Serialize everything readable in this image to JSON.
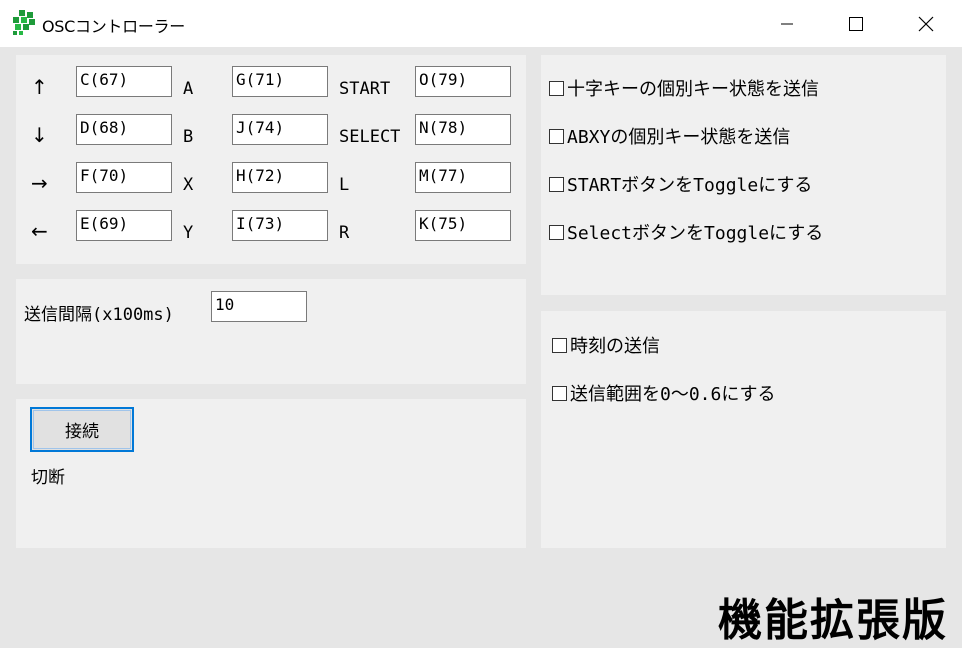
{
  "window": {
    "title": "OSCコントローラー",
    "icon": "leaf-app-icon",
    "controls": {
      "minimize": "minimize-icon",
      "maximize": "maximize-icon",
      "close": "close-icon"
    }
  },
  "keymap": {
    "dpad": [
      {
        "label": "↑",
        "value": "C(67)"
      },
      {
        "label": "↓",
        "value": "D(68)"
      },
      {
        "label": "→",
        "value": "F(70)"
      },
      {
        "label": "←",
        "value": "E(69)"
      }
    ],
    "face": [
      {
        "label": "A",
        "value": "G(71)"
      },
      {
        "label": "B",
        "value": "J(74)"
      },
      {
        "label": "X",
        "value": "H(72)"
      },
      {
        "label": "Y",
        "value": "I(73)"
      }
    ],
    "system": [
      {
        "label": "START",
        "value": "O(79)"
      },
      {
        "label": "SELECT",
        "value": "N(78)"
      },
      {
        "label": "L",
        "value": "M(77)"
      },
      {
        "label": "R",
        "value": "K(75)"
      }
    ]
  },
  "options": [
    {
      "label": "十字キーの個別キー状態を送信",
      "checked": false
    },
    {
      "label": "ABXYの個別キー状態を送信",
      "checked": false
    },
    {
      "label": "STARTボタンをToggleにする",
      "checked": false
    },
    {
      "label": "SelectボタンをToggleにする",
      "checked": false
    }
  ],
  "interval": {
    "label": "送信間隔(x100ms)",
    "value": "10"
  },
  "extra_options": [
    {
      "label": "時刻の送信",
      "checked": false
    },
    {
      "label": "送信範囲を0～0.6にする",
      "checked": false
    }
  ],
  "connection": {
    "button_label": "接続",
    "status": "切断"
  },
  "edition": "機能拡張版",
  "colors": {
    "accent": "#0078d7",
    "panel": "#f0f0f0",
    "background": "#e6e6e6",
    "icon_green": "#1e9b3a"
  }
}
